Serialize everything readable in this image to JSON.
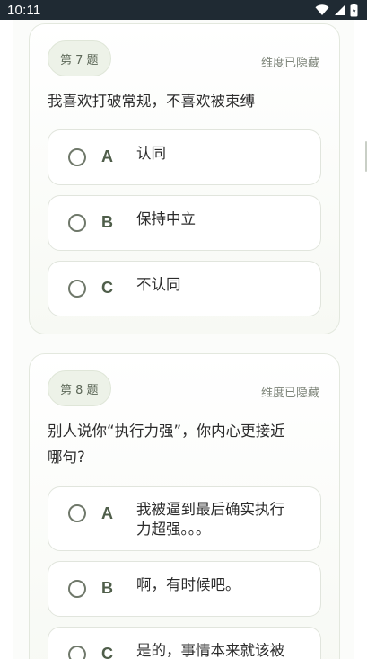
{
  "status_bar": {
    "time": "10:11"
  },
  "questions": [
    {
      "badge": "第 7 题",
      "dimension_note": "维度已隐藏",
      "text": "我喜欢打破常规，不喜欢被束缚",
      "options": [
        {
          "letter": "A",
          "text": "认同"
        },
        {
          "letter": "B",
          "text": "保持中立"
        },
        {
          "letter": "C",
          "text": "不认同"
        }
      ]
    },
    {
      "badge": "第 8 题",
      "dimension_note": "维度已隐藏",
      "text_line1": "别人说你“执行力强”，你内心更接近",
      "text_line2": "哪句?",
      "options": [
        {
          "letter": "A",
          "text_line1": "我被逼到最后确实执行",
          "text_line2": "力超强。。。"
        },
        {
          "letter": "B",
          "text": "啊，有时候吧。"
        },
        {
          "letter": "C",
          "text": "是的，事情本来就该被"
        }
      ]
    }
  ],
  "colors": {
    "status_bar": "#1f2a33",
    "badge_bg": "#edf2e8",
    "accent_letter": "#4f5e4a",
    "card_border": "#e3e8de"
  }
}
